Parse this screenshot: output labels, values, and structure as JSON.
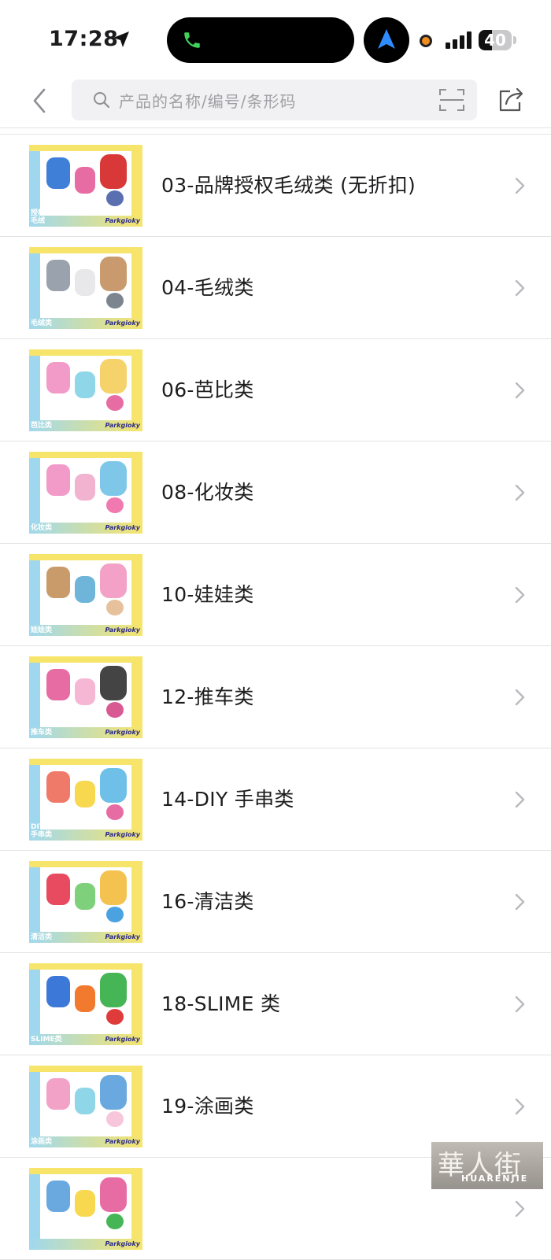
{
  "status_bar": {
    "time": "17:28",
    "battery": "40",
    "battery_level": 0.4,
    "icons": [
      "location-arrow-icon",
      "phone-icon",
      "navigation-icon",
      "recording-dot-icon",
      "signal-icon",
      "battery-icon"
    ]
  },
  "header": {
    "back_icon": "chevron-left-icon",
    "search_placeholder": "产品的名称/编号/条形码",
    "scan_icon": "scan-icon",
    "share_icon": "share-icon"
  },
  "categories": [
    {
      "label": "03-品牌授权毛绒类 (无折扣)",
      "tag": "授权类\n毛绒",
      "colors": [
        "#9fd8ee",
        "#f7e46b"
      ]
    },
    {
      "label": "04-毛绒类",
      "tag": "毛绒类",
      "colors": [
        "#9fd8ee",
        "#f7e46b"
      ]
    },
    {
      "label": "06-芭比类",
      "tag": "芭比类",
      "colors": [
        "#9fd8ee",
        "#f7e46b"
      ]
    },
    {
      "label": "08-化妆类",
      "tag": "化妆类",
      "colors": [
        "#9fd8ee",
        "#f7e46b"
      ]
    },
    {
      "label": "10-娃娃类",
      "tag": "娃娃类",
      "colors": [
        "#9fd8ee",
        "#f7e46b"
      ]
    },
    {
      "label": "12-推车类",
      "tag": "推车类",
      "colors": [
        "#9fd8ee",
        "#f7e46b"
      ]
    },
    {
      "label": "14-DIY 手串类",
      "tag": "DIY\n手串类",
      "colors": [
        "#9fd8ee",
        "#f7e46b"
      ]
    },
    {
      "label": "16-清洁类",
      "tag": "清洁类",
      "colors": [
        "#9fd8ee",
        "#f7e46b"
      ]
    },
    {
      "label": "18-SLIME 类",
      "tag": "SLIME类",
      "colors": [
        "#9fd8ee",
        "#f7e46b"
      ]
    },
    {
      "label": "19-涂画类",
      "tag": "涂画类",
      "colors": [
        "#9fd8ee",
        "#f7e46b"
      ]
    },
    {
      "label": "",
      "tag": "",
      "colors": [
        "#9fd8ee",
        "#f7e46b"
      ]
    }
  ],
  "brand_text": "Parkgioky",
  "watermark": {
    "cn": "華人街",
    "en": "HUARENJIE"
  }
}
